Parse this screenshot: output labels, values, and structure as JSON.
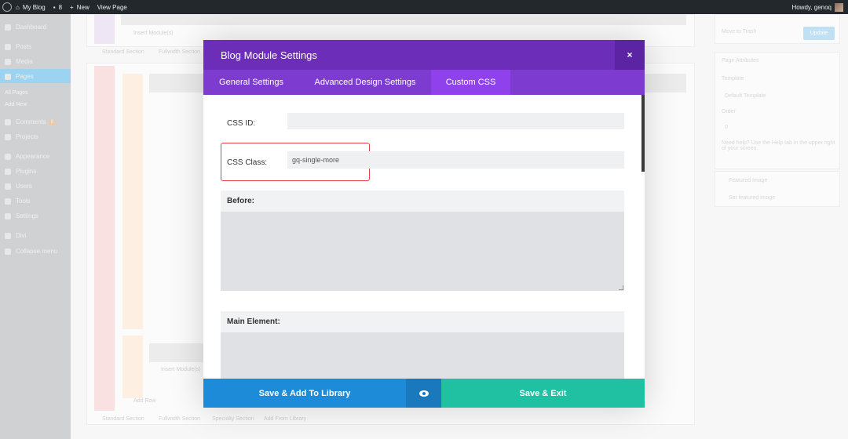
{
  "adminbar": {
    "site_name": "My Blog",
    "comments_count": "8",
    "new_label": "New",
    "view_page": "View Page",
    "howdy": "Howdy, genoq"
  },
  "sidebar": {
    "items": [
      {
        "label": "Dashboard",
        "icon": "dashboard-icon"
      },
      {
        "label": "Posts",
        "icon": "pin-icon"
      },
      {
        "label": "Media",
        "icon": "media-icon"
      },
      {
        "label": "Pages",
        "icon": "pages-icon"
      },
      {
        "label": "All Pages",
        "icon": ""
      },
      {
        "label": "Add New",
        "icon": ""
      },
      {
        "label": "Comments",
        "icon": "comment-icon"
      },
      {
        "label": "Projects",
        "icon": "projects-icon"
      },
      {
        "label": "Appearance",
        "icon": "brush-icon"
      },
      {
        "label": "Plugins",
        "icon": "plugin-icon"
      },
      {
        "label": "Users",
        "icon": "users-icon"
      },
      {
        "label": "Tools",
        "icon": "wrench-icon"
      },
      {
        "label": "Settings",
        "icon": "settings-icon"
      },
      {
        "label": "Divi",
        "icon": "divi-icon"
      },
      {
        "label": "Collapse menu",
        "icon": "collapse-icon"
      }
    ],
    "comments_badge": "8"
  },
  "canvas": {
    "insert_modules": "Insert Module(s)",
    "standard_section": "Standard Section",
    "fullwidth_section": "Fullwidth Section",
    "specialty_section": "Specialty Section",
    "add_from_library": "Add From Library",
    "add_row": "Add Row",
    "insert_module": "Insert Module(s)"
  },
  "rightpanel": {
    "move_to_trash": "Move to Trash",
    "update": "Update",
    "page_attributes": "Page Attributes",
    "template_label": "Template",
    "template_value": "Default Template",
    "order_label": "Order",
    "order_value": "0",
    "help_text": "Need help? Use the Help tab in the upper right of your screen.",
    "featured_image": "Featured Image",
    "set_featured": "Set featured image"
  },
  "modal": {
    "title": "Blog Module Settings",
    "close": "×",
    "tabs": [
      {
        "label": "General Settings",
        "active": false
      },
      {
        "label": "Advanced Design Settings",
        "active": false
      },
      {
        "label": "Custom CSS",
        "active": true
      }
    ],
    "fields": {
      "css_id_label": "CSS ID:",
      "css_id_value": "",
      "css_class_label": "CSS Class:",
      "css_class_value": "gq-single-more",
      "before_label": "Before:",
      "main_element_label": "Main Element:"
    },
    "footer": {
      "save_library": "Save & Add To Library",
      "save_exit": "Save & Exit",
      "preview_icon": "eye-icon"
    }
  },
  "colors": {
    "header": "#6c2eb9",
    "tabs": "#7e3bd0",
    "tab_active": "#8f42ec",
    "save_library": "#1e8bd8",
    "save_exit": "#20c0a2",
    "highlight": "#e0434a"
  }
}
